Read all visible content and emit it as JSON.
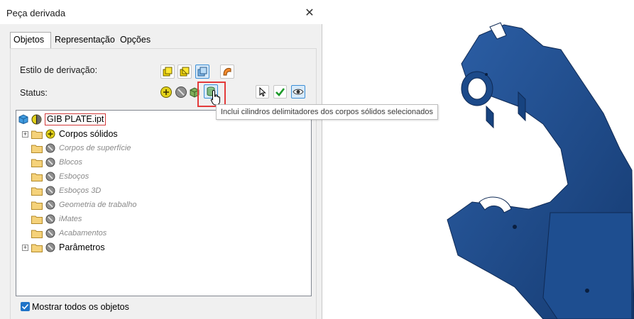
{
  "dialog": {
    "title": "Peça derivada",
    "close_glyph": "✕"
  },
  "tabs": [
    {
      "label": "Objetos",
      "active": true
    },
    {
      "label": "Representação",
      "active": false
    },
    {
      "label": "Opções",
      "active": false
    }
  ],
  "derive_style": {
    "label": "Estilo de derivação:",
    "buttons": [
      {
        "icon": "single-solid-merge-icon",
        "selected": false
      },
      {
        "icon": "single-solid-keep-seams-icon",
        "selected": false
      },
      {
        "icon": "multiple-solids-icon",
        "selected": true
      },
      {
        "icon": "surface-body-icon",
        "selected": false
      }
    ]
  },
  "status": {
    "label": "Status:",
    "buttons": [
      {
        "icon": "include-icon"
      },
      {
        "icon": "exclude-icon"
      },
      {
        "icon": "bounding-box-icon"
      },
      {
        "icon": "bounding-cylinder-icon"
      },
      {
        "icon": "select-cursor-icon"
      },
      {
        "icon": "check-icon"
      },
      {
        "icon": "visibility-eye-icon"
      }
    ]
  },
  "tooltip": {
    "text": "Inclui cilindros delimitadores dos corpos sólidos selecionados"
  },
  "tree": {
    "root": {
      "label": "GIB PLATE.ipt",
      "icon": "part-icon",
      "status": "mixed"
    },
    "items": [
      {
        "label": "Corpos sólidos",
        "status": "include",
        "expandable": true,
        "dim": false
      },
      {
        "label": "Corpos de superfície",
        "status": "exclude",
        "expandable": false,
        "dim": true
      },
      {
        "label": "Blocos",
        "status": "exclude",
        "expandable": false,
        "dim": true
      },
      {
        "label": "Esboços",
        "status": "exclude",
        "expandable": false,
        "dim": true
      },
      {
        "label": "Esboços 3D",
        "status": "exclude",
        "expandable": false,
        "dim": true
      },
      {
        "label": "Geometria de trabalho",
        "status": "exclude",
        "expandable": false,
        "dim": true
      },
      {
        "label": "iMates",
        "status": "exclude",
        "expandable": false,
        "dim": true
      },
      {
        "label": "Acabamentos",
        "status": "exclude",
        "expandable": false,
        "dim": true
      },
      {
        "label": "Parâmetros",
        "status": "exclude",
        "expandable": true,
        "dim": false
      }
    ]
  },
  "show_all": {
    "label": "Mostrar todos os objetos",
    "checked": true
  },
  "colors": {
    "model_blue": "#1f4f91",
    "highlight_red": "#e33b3b",
    "accent_blue": "#1f73c7"
  }
}
